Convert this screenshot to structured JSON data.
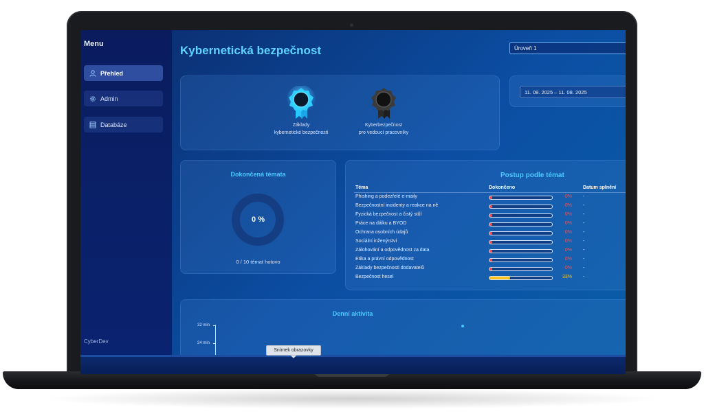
{
  "sidebar": {
    "title": "Menu",
    "items": [
      {
        "label": "Přehled",
        "icon": "user-icon",
        "active": true
      },
      {
        "label": "Admin",
        "icon": "gear-icon",
        "active": false
      },
      {
        "label": "Databáze",
        "icon": "database-icon",
        "active": false
      }
    ],
    "brand": "CyberDev"
  },
  "header": {
    "title": "Kybernetická bezpečnost",
    "level_select": "Úroveň 1"
  },
  "date_range": "11. 08. 2025 – 11. 08. 2025",
  "badges": [
    {
      "line1": "Základy",
      "line2": "kybernetické bezpečnosti",
      "status": "earned",
      "color": "#38c8ff"
    },
    {
      "line1": "Kyberbezpečnost",
      "line2": "pro vedoucí pracovníky",
      "status": "locked",
      "color": "#3a3a3a"
    }
  ],
  "completed": {
    "title": "Dokončená témata",
    "percent_label": "0 %",
    "percent": 0,
    "caption": "0 / 10 témat hotovo"
  },
  "progress": {
    "title": "Postup podle témat",
    "headers": {
      "topic": "Téma",
      "done": "Dokončeno",
      "date": "Datum splnění"
    },
    "rows": [
      {
        "topic": "Phishing a podezřelé e-maily",
        "pct": 0,
        "pct_label": "0%",
        "date": "-"
      },
      {
        "topic": "Bezpečnostní incidenty a reakce na ně",
        "pct": 0,
        "pct_label": "0%",
        "date": "-"
      },
      {
        "topic": "Fyzická bezpečnost a čistý stůl",
        "pct": 0,
        "pct_label": "0%",
        "date": "-"
      },
      {
        "topic": "Práce na dálku a BYOD",
        "pct": 0,
        "pct_label": "0%",
        "date": "-"
      },
      {
        "topic": "Ochrana osobních údajů",
        "pct": 0,
        "pct_label": "0%",
        "date": "-"
      },
      {
        "topic": "Sociální inženýrství",
        "pct": 0,
        "pct_label": "0%",
        "date": "-"
      },
      {
        "topic": "Zálohování a odpovědnost za data",
        "pct": 0,
        "pct_label": "0%",
        "date": "-"
      },
      {
        "topic": "Etika a právní odpovědnost",
        "pct": 0,
        "pct_label": "0%",
        "date": "-"
      },
      {
        "topic": "Základy bezpečnosti dodavatelů",
        "pct": 0,
        "pct_label": "0%",
        "date": "-"
      },
      {
        "topic": "Bezpečnost hesel",
        "pct": 33,
        "pct_label": "33%",
        "date": "-"
      }
    ],
    "color_low": "#ff4d4d",
    "color_mid": "#ffc21a"
  },
  "activity": {
    "title": "Denní aktivita",
    "y_ticks": [
      "32 min",
      "24 min"
    ]
  },
  "tooltip": "Snímek obrazovky"
}
